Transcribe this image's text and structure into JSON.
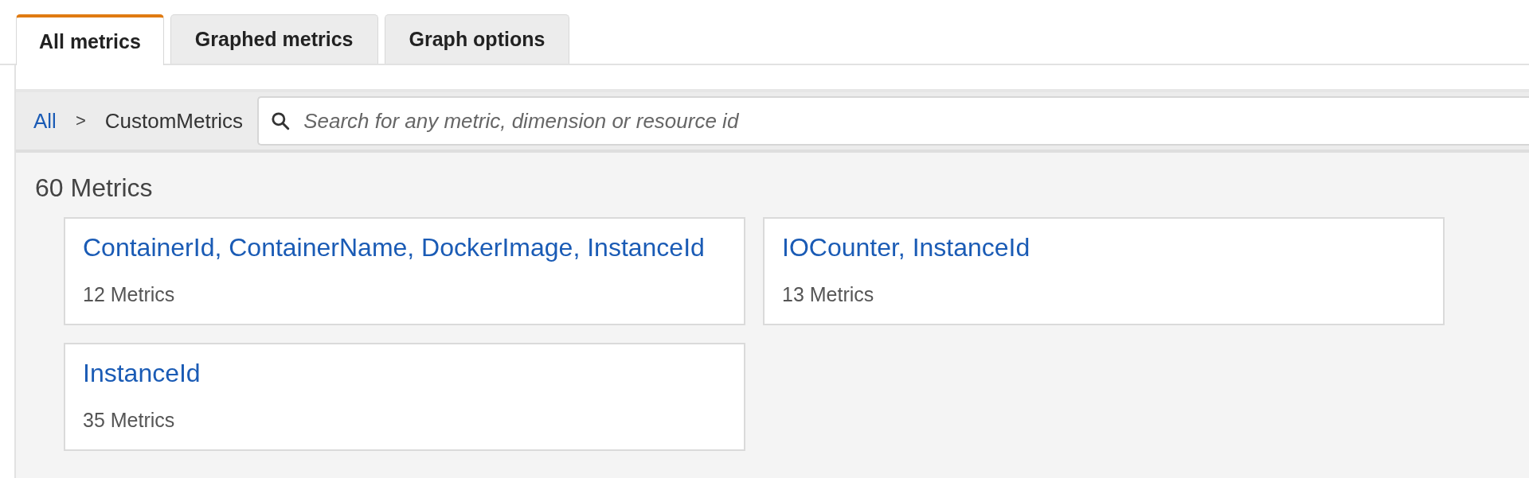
{
  "tabs": [
    {
      "label": "All metrics",
      "selected": true
    },
    {
      "label": "Graphed metrics",
      "selected": false
    },
    {
      "label": "Graph options",
      "selected": false
    }
  ],
  "breadcrumb": {
    "link": "All",
    "separator": ">",
    "current": "CustomMetrics"
  },
  "search": {
    "placeholder": "Search for any metric, dimension or resource id"
  },
  "metric_count": "60 Metrics",
  "groups": [
    {
      "title": "ContainerId, ContainerName, DockerImage, InstanceId",
      "count": "12 Metrics"
    },
    {
      "title": "IOCounter, InstanceId",
      "count": "13 Metrics"
    },
    {
      "title": "InstanceId",
      "count": "35 Metrics"
    }
  ]
}
